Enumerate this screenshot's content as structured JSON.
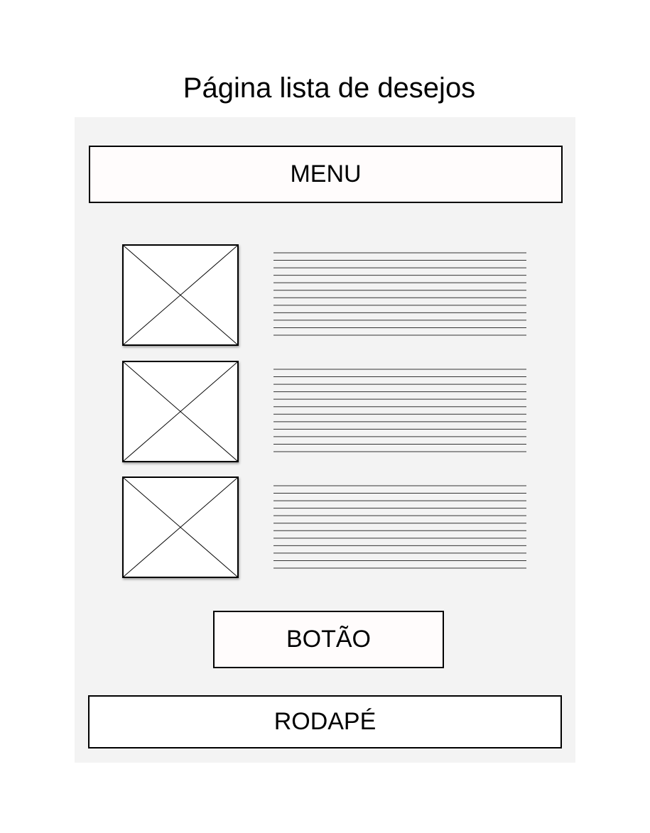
{
  "title": "Página lista de desejos",
  "menu": {
    "label": "MENU"
  },
  "items": [
    {
      "image_icon": "image-placeholder-icon",
      "text_lines": 12
    },
    {
      "image_icon": "image-placeholder-icon",
      "text_lines": 12
    },
    {
      "image_icon": "image-placeholder-icon",
      "text_lines": 12
    }
  ],
  "button": {
    "label": "BOTÃO"
  },
  "footer": {
    "label": "RODAPÉ"
  },
  "colors": {
    "panel_background": "#f3f3f3",
    "box_background": "#fffcfc",
    "stroke": "#000000"
  }
}
